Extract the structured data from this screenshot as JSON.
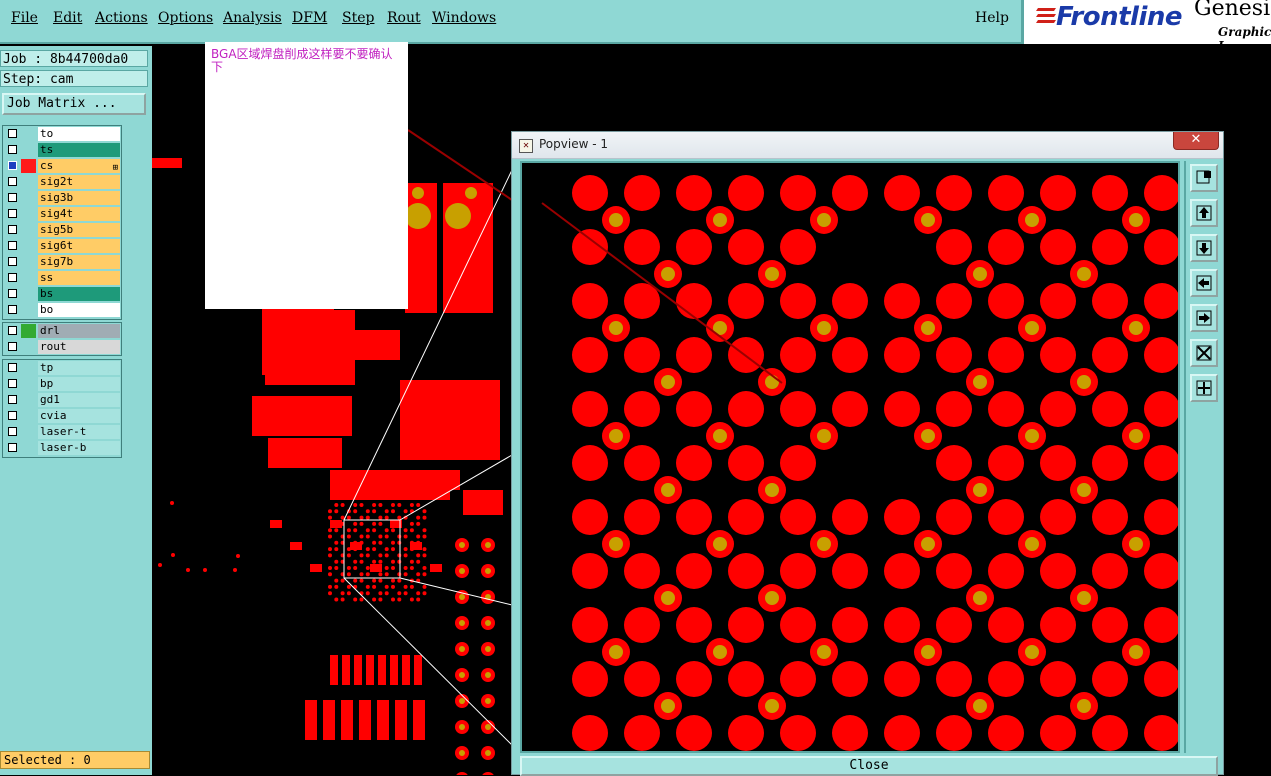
{
  "menu": {
    "items": [
      "File",
      "Actions",
      "Options",
      "Analysis",
      "DFM",
      "Step",
      "Rout",
      "Windows"
    ],
    "edit": "Edit",
    "help": "Help"
  },
  "logo": {
    "brand": "Frontline",
    "product": "Genesis",
    "subtitle": "Graphic I"
  },
  "job": {
    "label": "Job : 8b44700da0",
    "step": "Step: cam",
    "matrix_button": "Job Matrix ..."
  },
  "layers": [
    {
      "name": "to",
      "color": "#ffffff",
      "checked": false
    },
    {
      "name": "ts",
      "color": "#1e9a7a",
      "checked": false
    },
    {
      "name": "cs",
      "color": "#ffcc66",
      "checked": true,
      "swatch": "#ff1a1a"
    },
    {
      "name": "sig2t",
      "color": "#ffcc66",
      "checked": false
    },
    {
      "name": "sig3b",
      "color": "#ffcc66",
      "checked": false
    },
    {
      "name": "sig4t",
      "color": "#ffcc66",
      "checked": false
    },
    {
      "name": "sig5b",
      "color": "#ffcc66",
      "checked": false
    },
    {
      "name": "sig6t",
      "color": "#ffcc66",
      "checked": false
    },
    {
      "name": "sig7b",
      "color": "#ffcc66",
      "checked": false
    },
    {
      "name": "ss",
      "color": "#ffcc66",
      "checked": false
    },
    {
      "name": "bs",
      "color": "#1e9a7a",
      "checked": false
    },
    {
      "name": "bo",
      "color": "#ffffff",
      "checked": false
    }
  ],
  "drill_layers": [
    {
      "name": "drl",
      "color": "#a0acb4",
      "swatch": "#33aa33"
    },
    {
      "name": "rout",
      "color": "#d8d8d8"
    }
  ],
  "misc_layers": [
    {
      "name": "tp",
      "color": "#a6e3df"
    },
    {
      "name": "bp",
      "color": "#a6e3df"
    },
    {
      "name": "gd1",
      "color": "#a6e3df"
    },
    {
      "name": "cvia",
      "color": "#a6e3df"
    },
    {
      "name": "laser-t",
      "color": "#a6e3df"
    },
    {
      "name": "laser-b",
      "color": "#a6e3df"
    }
  ],
  "status": {
    "selected": "Selected : 0"
  },
  "note": {
    "text": "BGA区域焊盘削成这样要不要确认下"
  },
  "popview": {
    "title": "Popview - 1",
    "close_x": "✕",
    "close_label": "Close"
  },
  "icons": {
    "pv_tools": [
      "zoom-window-icon",
      "pan-up-icon",
      "pan-down-icon",
      "pan-left-icon",
      "pan-right-icon",
      "zoom-fit-icon",
      "zoom-center-icon"
    ]
  },
  "colors": {
    "ui": "#8fd8d4",
    "copper": "#ff0000",
    "via": "#c8a000",
    "note_text": "#c021c0"
  }
}
